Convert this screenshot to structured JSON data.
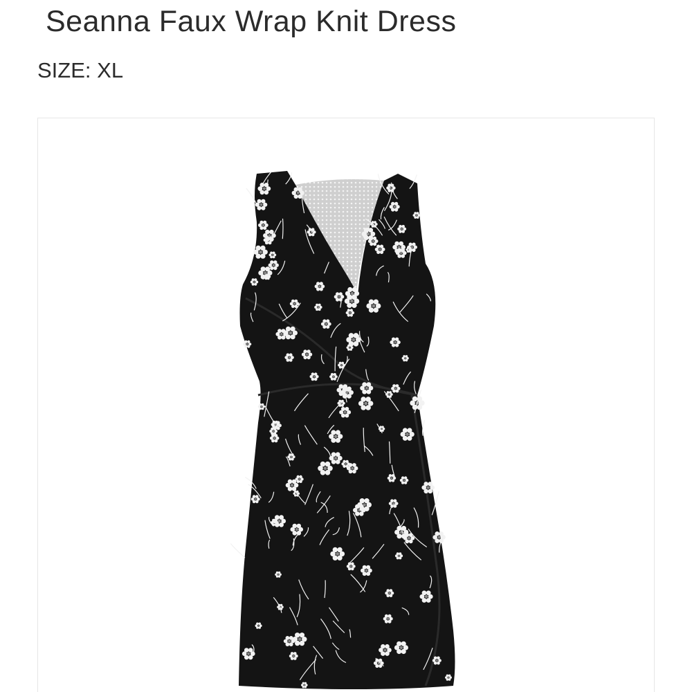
{
  "product": {
    "title": "Seanna Faux Wrap Knit Dress",
    "size_label": "SIZE:",
    "size_value": "XL"
  },
  "image": {
    "subject": "dress-image",
    "dress_color": "#141414",
    "print_color": "#f2f2f2",
    "lining_color": "#dcdcdc"
  }
}
